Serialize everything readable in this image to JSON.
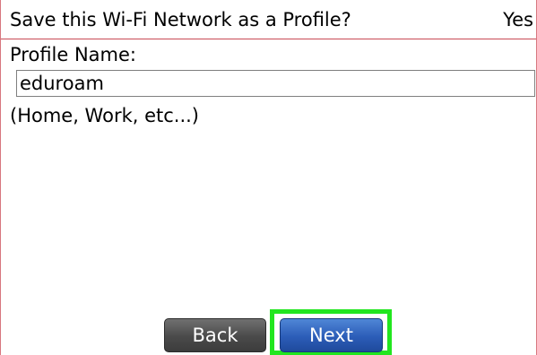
{
  "save_profile": {
    "label": "Save this Wi-Fi Network as a Profile?",
    "value": "Yes"
  },
  "profile_name": {
    "label": "Profile Name:",
    "value": "eduroam",
    "hint": "(Home, Work, etc...)"
  },
  "buttons": {
    "back": "Back",
    "next": "Next"
  },
  "colors": {
    "highlight": "#22e61f",
    "next_button": "#2c5db8",
    "back_button": "#4a4a4a",
    "divider": "#c84a55"
  }
}
